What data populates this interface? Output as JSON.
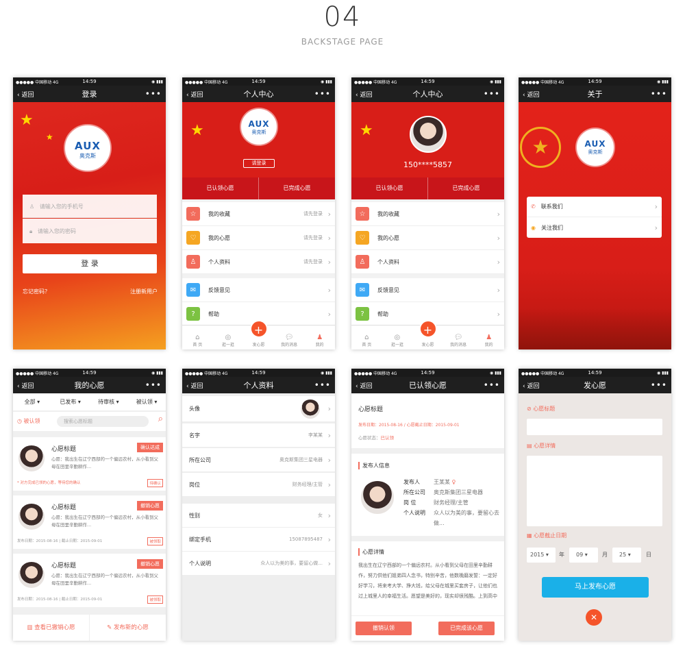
{
  "header": {
    "number": "04",
    "subtitle": "BACKSTAGE PAGE"
  },
  "status": {
    "carrier": "●●●●● 中国移动 4G",
    "time": "14:59",
    "battery": "◉ ▮▮▮"
  },
  "common": {
    "back": "返回",
    "more": "•••"
  },
  "tabbar": {
    "home": "首 页",
    "explore": "逛一逛",
    "wish": "发心愿",
    "messages": "我的消息",
    "mine": "我的"
  },
  "logo": {
    "brand": "AUX",
    "cn": "奥克斯"
  },
  "login": {
    "title": "登录",
    "phone_placeholder": "请输入您的手机号",
    "password_placeholder": "请输入您的密码",
    "submit": "登 录",
    "forgot": "忘记密码？",
    "register": "注册新用户"
  },
  "center1": {
    "title": "个人中心",
    "login_btn": "请登录",
    "seg": [
      "已认领心愿",
      "已完成心愿"
    ],
    "items": [
      {
        "label": "我的收藏",
        "value": "请先登录"
      },
      {
        "label": "我的心愿",
        "value": "请先登录"
      },
      {
        "label": "个人资料",
        "value": "请先登录"
      },
      {
        "label": "反馈意见",
        "value": ""
      },
      {
        "label": "帮助",
        "value": ""
      }
    ]
  },
  "center2": {
    "title": "个人中心",
    "phone": "150****5857",
    "seg": [
      "已认领心愿",
      "已完成心愿"
    ],
    "items": [
      "我的收藏",
      "我的心愿",
      "个人资料",
      "反馈意见",
      "帮助"
    ]
  },
  "about": {
    "title": "关于",
    "items": [
      "联系我们",
      "关注我们"
    ]
  },
  "mywish": {
    "title": "我的心愿",
    "filters": [
      "全部",
      "已发布",
      "待审核",
      "被认领"
    ],
    "claimed": "被认领",
    "search_placeholder": "搜索心愿标题",
    "cards": [
      {
        "title": "心愿标题",
        "tag": "确认达成",
        "desc": "心愿：我出生在辽宁西部的一个偏远农村，从小看到父母在田里辛勤耕作...",
        "foot": "* 对方完成已领的心愿，等待您的确认",
        "badge": "待确认"
      },
      {
        "title": "心愿标题",
        "tag": "撤销心愿",
        "desc": "心愿：我出生在辽宁西部的一个偏远农村，从小看到父母在田里辛勤耕作...",
        "foot": "发布日期：2015-08-16  |  截止日期：2015-09-01",
        "badge": "被领取"
      },
      {
        "title": "心愿标题",
        "tag": "撤销心愿",
        "desc": "心愿：我出生在辽宁西部的一个偏远农村，从小看到父母在田里辛勤耕作...",
        "foot": "发布日期：2015-08-16  |  截止日期：2015-09-01",
        "badge": "被领取"
      }
    ],
    "view_revoked": "查看已撤销心愿",
    "publish_new": "发布新的心愿"
  },
  "profile": {
    "title": "个人资料",
    "rows": [
      {
        "label": "头像",
        "value": ""
      },
      {
        "label": "名字",
        "value": "李某某"
      },
      {
        "label": "所在公司",
        "value": "奥克斯集团三星电器"
      },
      {
        "label": "岗位",
        "value": "财务经理/主管"
      },
      {
        "label": "性别",
        "value": "女"
      },
      {
        "label": "绑定手机",
        "value": "15087895487"
      },
      {
        "label": "个人说明",
        "value": "众人以为美的事，要留心做..."
      }
    ]
  },
  "claimed": {
    "title": "已认领心愿",
    "wish_title": "心愿标题",
    "dates": "发布日期：2015-08-16  /  心愿截止日期：2015-09-01",
    "state_label": "心愿状态：",
    "state": "已认领",
    "publisher_head": "发布人信息",
    "publisher": [
      {
        "k": "发布人",
        "v": "王某某"
      },
      {
        "k": "所在公司",
        "v": "奥克斯集团三星电器"
      },
      {
        "k": "岗 位",
        "v": "财务经理/主管"
      },
      {
        "k": "个人说明",
        "v": "众人以为美的事，要留心去做..."
      }
    ],
    "detail_head": "心愿详情",
    "detail": "我出生在辽宁西部的一个偏远农村。从小看到父母在田里辛勤耕作，努力供他们姐弟四人念书，特别辛苦，他数晚磨发誓：一定好好学习，将来考大学、挣大钱，给父母在城里买套房子，让他们也过上城里人的幸福生活。愿望是美好的，现实却很残酷。上到高中",
    "cancel": "撤销认领",
    "done": "已完成该心愿"
  },
  "publish": {
    "title": "发心愿",
    "title_label": "心愿标题",
    "detail_label": "心愿详情",
    "deadline_label": "心愿截止日期",
    "year": "2015",
    "month": "09",
    "day": "25",
    "unit_y": "年",
    "unit_m": "月",
    "unit_d": "日",
    "submit": "马上发布心愿"
  },
  "colors": {
    "red": "#d81e18",
    "accent": "#f26c5c",
    "blue": "#1ab0e8"
  }
}
